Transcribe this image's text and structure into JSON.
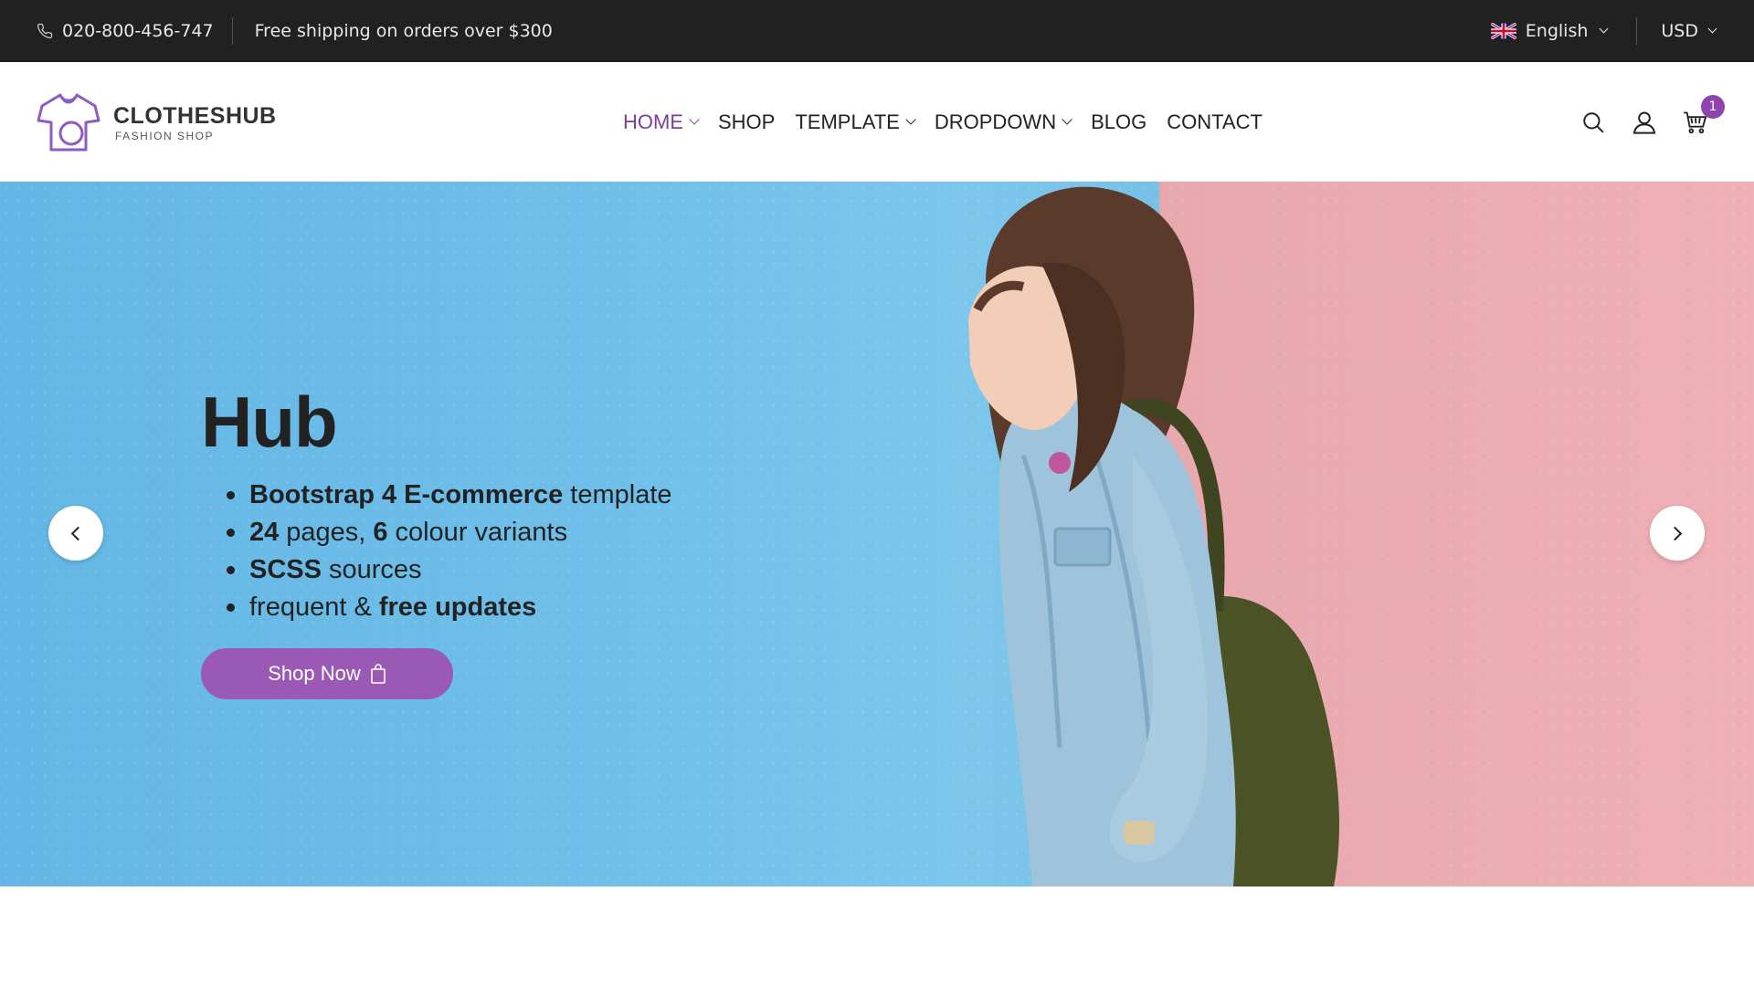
{
  "topbar": {
    "phone": "020-800-456-747",
    "shipping": "Free shipping on orders over $300",
    "language": "English",
    "currency": "USD"
  },
  "header": {
    "logo_title": "CLOTHESHUB",
    "logo_subtitle": "FASHION SHOP",
    "nav": [
      {
        "label": "HOME",
        "active": true,
        "dropdown": true
      },
      {
        "label": "SHOP",
        "active": false,
        "dropdown": false
      },
      {
        "label": "TEMPLATE",
        "active": false,
        "dropdown": true
      },
      {
        "label": "DROPDOWN",
        "active": false,
        "dropdown": true
      },
      {
        "label": "BLOG",
        "active": false,
        "dropdown": false
      },
      {
        "label": "CONTACT",
        "active": false,
        "dropdown": false
      }
    ],
    "icons": [
      "search-icon",
      "user-icon",
      "cart-icon"
    ],
    "cart_count": "1"
  },
  "hero": {
    "title": "Hub",
    "bullets": [
      {
        "bold": "Bootstrap 4 E-commerce",
        "text": "template"
      },
      {
        "bold": "24",
        "text": "pages,",
        "bold2": "6",
        "text2": "colour variants"
      },
      {
        "bold": "SCSS",
        "text": "sources"
      },
      {
        "text": "frequent &",
        "bold": "free updates"
      }
    ],
    "button": "Shop Now"
  },
  "colors": {
    "accent": "#9b59b6",
    "active_nav": "#7d3c98",
    "topbar_bg": "#212121",
    "hero_blue": "#6fbfe9",
    "hero_pink": "#eeb0b6"
  }
}
